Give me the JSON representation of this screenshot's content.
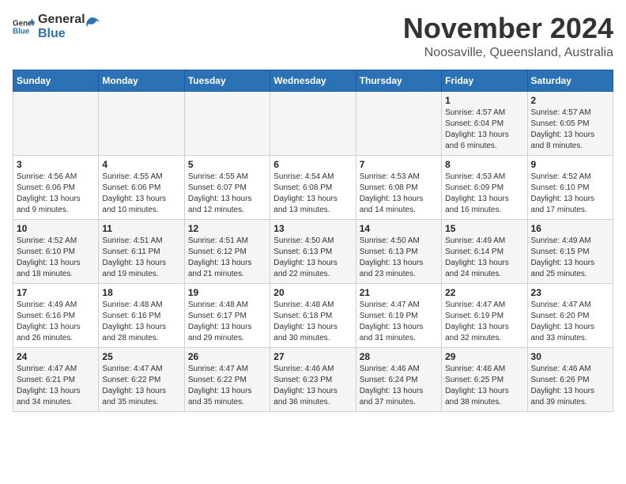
{
  "header": {
    "logo_general": "General",
    "logo_blue": "Blue",
    "main_title": "November 2024",
    "subtitle": "Noosaville, Queensland, Australia"
  },
  "weekdays": [
    "Sunday",
    "Monday",
    "Tuesday",
    "Wednesday",
    "Thursday",
    "Friday",
    "Saturday"
  ],
  "weeks": [
    [
      {
        "day": "",
        "info": ""
      },
      {
        "day": "",
        "info": ""
      },
      {
        "day": "",
        "info": ""
      },
      {
        "day": "",
        "info": ""
      },
      {
        "day": "",
        "info": ""
      },
      {
        "day": "1",
        "info": "Sunrise: 4:57 AM\nSunset: 6:04 PM\nDaylight: 13 hours and 6 minutes."
      },
      {
        "day": "2",
        "info": "Sunrise: 4:57 AM\nSunset: 6:05 PM\nDaylight: 13 hours and 8 minutes."
      }
    ],
    [
      {
        "day": "3",
        "info": "Sunrise: 4:56 AM\nSunset: 6:06 PM\nDaylight: 13 hours and 9 minutes."
      },
      {
        "day": "4",
        "info": "Sunrise: 4:55 AM\nSunset: 6:06 PM\nDaylight: 13 hours and 10 minutes."
      },
      {
        "day": "5",
        "info": "Sunrise: 4:55 AM\nSunset: 6:07 PM\nDaylight: 13 hours and 12 minutes."
      },
      {
        "day": "6",
        "info": "Sunrise: 4:54 AM\nSunset: 6:08 PM\nDaylight: 13 hours and 13 minutes."
      },
      {
        "day": "7",
        "info": "Sunrise: 4:53 AM\nSunset: 6:08 PM\nDaylight: 13 hours and 14 minutes."
      },
      {
        "day": "8",
        "info": "Sunrise: 4:53 AM\nSunset: 6:09 PM\nDaylight: 13 hours and 16 minutes."
      },
      {
        "day": "9",
        "info": "Sunrise: 4:52 AM\nSunset: 6:10 PM\nDaylight: 13 hours and 17 minutes."
      }
    ],
    [
      {
        "day": "10",
        "info": "Sunrise: 4:52 AM\nSunset: 6:10 PM\nDaylight: 13 hours and 18 minutes."
      },
      {
        "day": "11",
        "info": "Sunrise: 4:51 AM\nSunset: 6:11 PM\nDaylight: 13 hours and 19 minutes."
      },
      {
        "day": "12",
        "info": "Sunrise: 4:51 AM\nSunset: 6:12 PM\nDaylight: 13 hours and 21 minutes."
      },
      {
        "day": "13",
        "info": "Sunrise: 4:50 AM\nSunset: 6:13 PM\nDaylight: 13 hours and 22 minutes."
      },
      {
        "day": "14",
        "info": "Sunrise: 4:50 AM\nSunset: 6:13 PM\nDaylight: 13 hours and 23 minutes."
      },
      {
        "day": "15",
        "info": "Sunrise: 4:49 AM\nSunset: 6:14 PM\nDaylight: 13 hours and 24 minutes."
      },
      {
        "day": "16",
        "info": "Sunrise: 4:49 AM\nSunset: 6:15 PM\nDaylight: 13 hours and 25 minutes."
      }
    ],
    [
      {
        "day": "17",
        "info": "Sunrise: 4:49 AM\nSunset: 6:16 PM\nDaylight: 13 hours and 26 minutes."
      },
      {
        "day": "18",
        "info": "Sunrise: 4:48 AM\nSunset: 6:16 PM\nDaylight: 13 hours and 28 minutes."
      },
      {
        "day": "19",
        "info": "Sunrise: 4:48 AM\nSunset: 6:17 PM\nDaylight: 13 hours and 29 minutes."
      },
      {
        "day": "20",
        "info": "Sunrise: 4:48 AM\nSunset: 6:18 PM\nDaylight: 13 hours and 30 minutes."
      },
      {
        "day": "21",
        "info": "Sunrise: 4:47 AM\nSunset: 6:19 PM\nDaylight: 13 hours and 31 minutes."
      },
      {
        "day": "22",
        "info": "Sunrise: 4:47 AM\nSunset: 6:19 PM\nDaylight: 13 hours and 32 minutes."
      },
      {
        "day": "23",
        "info": "Sunrise: 4:47 AM\nSunset: 6:20 PM\nDaylight: 13 hours and 33 minutes."
      }
    ],
    [
      {
        "day": "24",
        "info": "Sunrise: 4:47 AM\nSunset: 6:21 PM\nDaylight: 13 hours and 34 minutes."
      },
      {
        "day": "25",
        "info": "Sunrise: 4:47 AM\nSunset: 6:22 PM\nDaylight: 13 hours and 35 minutes."
      },
      {
        "day": "26",
        "info": "Sunrise: 4:47 AM\nSunset: 6:22 PM\nDaylight: 13 hours and 35 minutes."
      },
      {
        "day": "27",
        "info": "Sunrise: 4:46 AM\nSunset: 6:23 PM\nDaylight: 13 hours and 36 minutes."
      },
      {
        "day": "28",
        "info": "Sunrise: 4:46 AM\nSunset: 6:24 PM\nDaylight: 13 hours and 37 minutes."
      },
      {
        "day": "29",
        "info": "Sunrise: 4:46 AM\nSunset: 6:25 PM\nDaylight: 13 hours and 38 minutes."
      },
      {
        "day": "30",
        "info": "Sunrise: 4:46 AM\nSunset: 6:26 PM\nDaylight: 13 hours and 39 minutes."
      }
    ]
  ]
}
